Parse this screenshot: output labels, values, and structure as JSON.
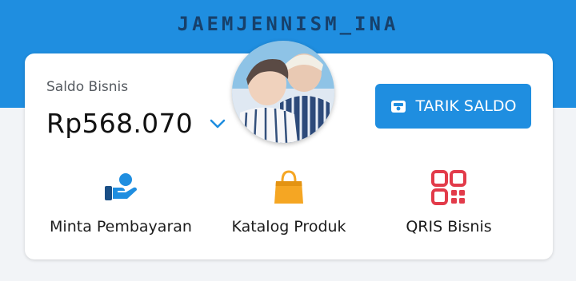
{
  "header": {
    "title": "JAEMJENNISM_INA"
  },
  "balance": {
    "label": "Saldo Bisnis",
    "amount": "Rp568.070",
    "toggle_icon": "chevron-down-icon"
  },
  "withdraw": {
    "label": "TARIK SALDO",
    "icon": "wallet-icon"
  },
  "actions": [
    {
      "label": "Minta Pembayaran",
      "icon": "hand-coin-icon",
      "color": "#1f8ee0"
    },
    {
      "label": "Katalog Produk",
      "icon": "shopping-bag-icon",
      "color": "#f5a623"
    },
    {
      "label": "QRIS Bisnis",
      "icon": "qr-code-icon",
      "color": "#e23b4a"
    }
  ],
  "colors": {
    "accent": "#1f8ee0",
    "header_text": "#17406a",
    "bag": "#f5a623",
    "qris": "#e23b4a"
  }
}
